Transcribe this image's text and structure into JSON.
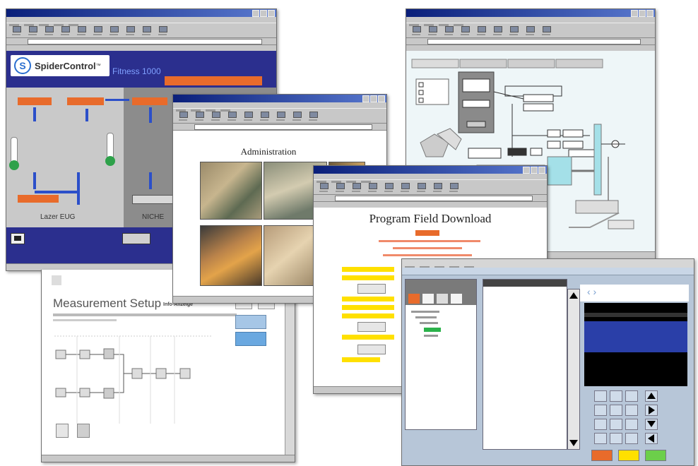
{
  "spider": {
    "logo_text": "SpiderControl",
    "logo_tm": "™",
    "page_header": "Fitness 1000",
    "banner": "",
    "left_zone": "Lazer EUG",
    "right_zone": "NICHE",
    "button_label": "",
    "colors": {
      "bg": "#2b2f8e",
      "panel": "#c9c9c9",
      "orange": "#e86b2b",
      "arrow": "#2b4fc9"
    }
  },
  "admin": {
    "heading": "Administration"
  },
  "download": {
    "heading": "Program Field Download"
  },
  "measurement": {
    "heading": "Measurement Setup",
    "sub_label": "Info-Anzeige"
  },
  "plc": {},
  "icons": [
    "spider-logo-icon",
    "thermometer-icon",
    "arrow-up-icon",
    "arrow-down-icon",
    "arrow-right-icon",
    "arrow-left-icon"
  ]
}
